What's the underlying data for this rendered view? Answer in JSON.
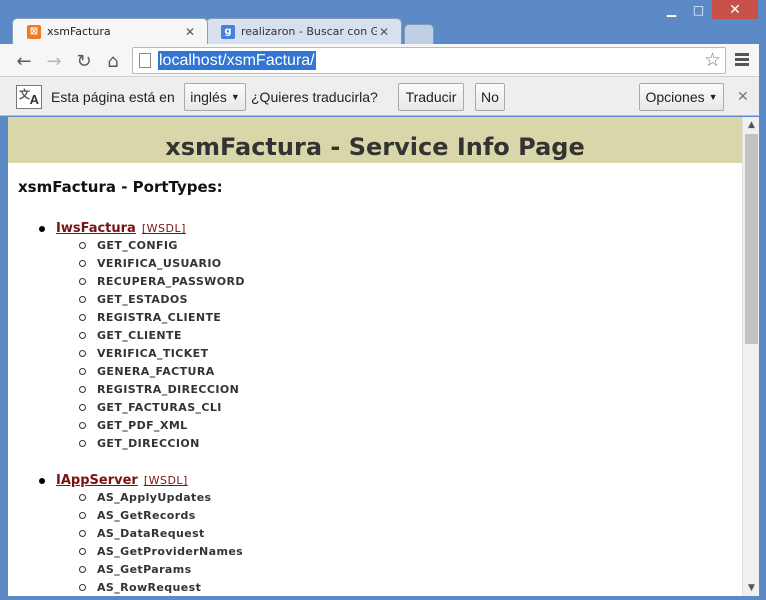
{
  "window": {
    "minimize": "▁",
    "maximize": "□",
    "close": "✕"
  },
  "tabs": [
    {
      "title": "xsmFactura",
      "icon": "xampp-icon"
    },
    {
      "title": "realizaron - Buscar con Go",
      "icon": "google-icon"
    }
  ],
  "address_bar": {
    "url": "localhost/xsmFactura/"
  },
  "translate_bar": {
    "prefix": "Esta página está en",
    "language": "inglés",
    "question": "¿Quieres traducirla?",
    "translate_button": "Traducir",
    "no_button": "No",
    "options_button": "Opciones"
  },
  "page": {
    "title": "xsmFactura - Service Info Page",
    "subtitle": "xsmFactura - PortTypes:",
    "port_types": [
      {
        "name": "IwsFactura",
        "wsdl": "[WSDL]",
        "operations": [
          "GET_CONFIG",
          "VERIFICA_USUARIO",
          "RECUPERA_PASSWORD",
          "GET_ESTADOS",
          "REGISTRA_CLIENTE",
          "GET_CLIENTE",
          "VERIFICA_TICKET",
          "GENERA_FACTURA",
          "REGISTRA_DIRECCION",
          "GET_FACTURAS_CLI",
          "GET_PDF_XML",
          "GET_DIRECCION"
        ]
      },
      {
        "name": "IAppServer",
        "wsdl": "[WSDL]",
        "operations": [
          "AS_ApplyUpdates",
          "AS_GetRecords",
          "AS_DataRequest",
          "AS_GetProviderNames",
          "AS_GetParams",
          "AS_RowRequest"
        ]
      }
    ]
  }
}
